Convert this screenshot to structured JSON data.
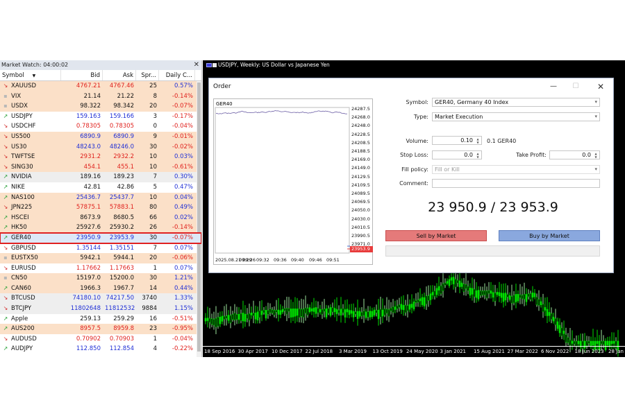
{
  "market_watch": {
    "title": "Market Watch: 04:00:02",
    "columns": [
      "Symbol",
      "Bid",
      "Ask",
      "Spr...",
      "Daily C..."
    ],
    "rows": [
      {
        "symbol": "XAUUSD",
        "bid": "4767.21",
        "ask": "4767.46",
        "spread": "25",
        "change": "0.57%",
        "dir": "down",
        "bg": "orange",
        "price_color": "red",
        "change_color": "blue"
      },
      {
        "symbol": "VIX",
        "bid": "21.14",
        "ask": "21.22",
        "spread": "8",
        "change": "-0.14%",
        "dir": "flat",
        "bg": "orange",
        "price_color": "black",
        "change_color": "red"
      },
      {
        "symbol": "USDX",
        "bid": "98.322",
        "ask": "98.342",
        "spread": "20",
        "change": "-0.07%",
        "dir": "flat",
        "bg": "orange",
        "price_color": "black",
        "change_color": "red"
      },
      {
        "symbol": "USDJPY",
        "bid": "159.163",
        "ask": "159.166",
        "spread": "3",
        "change": "-0.17%",
        "dir": "up",
        "bg": "white",
        "price_color": "blue",
        "change_color": "red"
      },
      {
        "symbol": "USDCHF",
        "bid": "0.78305",
        "ask": "0.78305",
        "spread": "0",
        "change": "-0.04%",
        "dir": "down",
        "bg": "white",
        "price_color": "red",
        "change_color": "red"
      },
      {
        "symbol": "US500",
        "bid": "6890.9",
        "ask": "6890.9",
        "spread": "9",
        "change": "-0.01%",
        "dir": "down",
        "bg": "orange",
        "price_color": "blue",
        "change_color": "red"
      },
      {
        "symbol": "US30",
        "bid": "48243.0",
        "ask": "48246.0",
        "spread": "30",
        "change": "-0.02%",
        "dir": "down",
        "bg": "orange",
        "price_color": "blue",
        "change_color": "red"
      },
      {
        "symbol": "TWFTSE",
        "bid": "2931.2",
        "ask": "2932.2",
        "spread": "10",
        "change": "0.03%",
        "dir": "down",
        "bg": "orange",
        "price_color": "red",
        "change_color": "blue"
      },
      {
        "symbol": "SING30",
        "bid": "454.1",
        "ask": "455.1",
        "spread": "10",
        "change": "-0.61%",
        "dir": "down",
        "bg": "orange",
        "price_color": "red",
        "change_color": "red"
      },
      {
        "symbol": "NVIDIA",
        "bid": "189.16",
        "ask": "189.23",
        "spread": "7",
        "change": "0.30%",
        "dir": "up",
        "bg": "gray",
        "price_color": "black",
        "change_color": "blue"
      },
      {
        "symbol": "NIKE",
        "bid": "42.81",
        "ask": "42.86",
        "spread": "5",
        "change": "0.47%",
        "dir": "up",
        "bg": "white",
        "price_color": "black",
        "change_color": "blue"
      },
      {
        "symbol": "NAS100",
        "bid": "25436.7",
        "ask": "25437.7",
        "spread": "10",
        "change": "0.04%",
        "dir": "up",
        "bg": "orange",
        "price_color": "blue",
        "change_color": "blue"
      },
      {
        "symbol": "JPN225",
        "bid": "57875.1",
        "ask": "57883.1",
        "spread": "80",
        "change": "0.49%",
        "dir": "down",
        "bg": "orange",
        "price_color": "red",
        "change_color": "blue"
      },
      {
        "symbol": "HSCEI",
        "bid": "8673.9",
        "ask": "8680.5",
        "spread": "66",
        "change": "0.02%",
        "dir": "up",
        "bg": "orange",
        "price_color": "black",
        "change_color": "blue"
      },
      {
        "symbol": "HK50",
        "bid": "25927.6",
        "ask": "25930.2",
        "spread": "26",
        "change": "-0.14%",
        "dir": "up",
        "bg": "orange",
        "price_color": "black",
        "change_color": "red"
      },
      {
        "symbol": "GER40",
        "bid": "23950.9",
        "ask": "23953.9",
        "spread": "30",
        "change": "-0.07%",
        "dir": "up",
        "bg": "blue",
        "price_color": "blue",
        "change_color": "red",
        "highlight": true
      },
      {
        "symbol": "GBPUSD",
        "bid": "1.35144",
        "ask": "1.35151",
        "spread": "7",
        "change": "0.07%",
        "dir": "down",
        "bg": "white",
        "price_color": "blue",
        "change_color": "blue"
      },
      {
        "symbol": "EUSTX50",
        "bid": "5942.1",
        "ask": "5944.1",
        "spread": "20",
        "change": "-0.06%",
        "dir": "flat",
        "bg": "orange",
        "price_color": "black",
        "change_color": "red"
      },
      {
        "symbol": "EURUSD",
        "bid": "1.17662",
        "ask": "1.17663",
        "spread": "1",
        "change": "0.07%",
        "dir": "down",
        "bg": "white",
        "price_color": "red",
        "change_color": "blue"
      },
      {
        "symbol": "CN50",
        "bid": "15197.0",
        "ask": "15200.0",
        "spread": "30",
        "change": "1.21%",
        "dir": "flat",
        "bg": "orange",
        "price_color": "black",
        "change_color": "blue"
      },
      {
        "symbol": "CAN60",
        "bid": "1966.3",
        "ask": "1967.7",
        "spread": "14",
        "change": "0.44%",
        "dir": "up",
        "bg": "orange",
        "price_color": "black",
        "change_color": "blue"
      },
      {
        "symbol": "BTCUSD",
        "bid": "74180.10",
        "ask": "74217.50",
        "spread": "3740",
        "change": "1.33%",
        "dir": "down",
        "bg": "gray",
        "price_color": "blue",
        "change_color": "blue"
      },
      {
        "symbol": "BTCJPY",
        "bid": "11802648",
        "ask": "11812532",
        "spread": "9884",
        "change": "1.15%",
        "dir": "down",
        "bg": "gray",
        "price_color": "blue",
        "change_color": "blue"
      },
      {
        "symbol": "Apple",
        "bid": "259.13",
        "ask": "259.29",
        "spread": "16",
        "change": "-0.51%",
        "dir": "up",
        "bg": "white",
        "price_color": "black",
        "change_color": "red"
      },
      {
        "symbol": "AUS200",
        "bid": "8957.5",
        "ask": "8959.8",
        "spread": "23",
        "change": "-0.95%",
        "dir": "up",
        "bg": "orange",
        "price_color": "red",
        "change_color": "red"
      },
      {
        "symbol": "AUDUSD",
        "bid": "0.70902",
        "ask": "0.70903",
        "spread": "1",
        "change": "-0.04%",
        "dir": "down",
        "bg": "white",
        "price_color": "red",
        "change_color": "red"
      },
      {
        "symbol": "AUDJPY",
        "bid": "112.850",
        "ask": "112.854",
        "spread": "4",
        "change": "-0.22%",
        "dir": "up",
        "bg": "white",
        "price_color": "blue",
        "change_color": "red"
      }
    ]
  },
  "chart_window": {
    "title": "USDJPY, Weekly:  US Dollar vs Japanese Yen",
    "x_labels": [
      "18 Sep 2016",
      "30 Apr 2017",
      "10 Dec 2017",
      "22 Jul 2018",
      "3 Mar 2019",
      "13 Oct 2019",
      "24 May 2020",
      "3 Jan 2021",
      "15 Aug 2021",
      "27 Mar 2022",
      "6 Nov 2022",
      "18 Jun 2023",
      "28 Jan"
    ],
    "colors": {
      "background": "#000000",
      "bull": "#00e000",
      "bear": "#ffffff"
    }
  },
  "order_dialog": {
    "title": "Order",
    "controls": {
      "minimize": "—",
      "maximize": "☐",
      "close": "✕"
    },
    "mini_chart": {
      "symbol": "GER40",
      "price_labels": [
        "24287.5",
        "24268.0",
        "24248.0",
        "24228.5",
        "24208.5",
        "24188.5",
        "24169.0",
        "24149.0",
        "24129.5",
        "24109.5",
        "24089.5",
        "24069.5",
        "24050.0",
        "24030.0",
        "24010.5",
        "23990.5",
        "23971.0"
      ],
      "current_bid": "23953.9",
      "time_labels": [
        "2025.08.21 09:26",
        "09:29",
        "09:32",
        "09:36",
        "09:40",
        "09:46",
        "09:51"
      ],
      "line_color": "#7b6fae"
    },
    "form": {
      "symbol_label": "Symbol:",
      "symbol_value": "GER40, Germany 40 Index",
      "type_label": "Type:",
      "type_value": "Market Execution",
      "volume_label": "Volume:",
      "volume_value": "0.10",
      "volume_note": "0.1 GER40",
      "stop_loss_label": "Stop Loss:",
      "stop_loss_value": "0.0",
      "take_profit_label": "Take Profit:",
      "take_profit_value": "0.0",
      "fill_policy_label": "Fill policy:",
      "fill_policy_value": "Fill or Kill",
      "comment_label": "Comment:",
      "comment_value": ""
    },
    "quote": "23 950.9 / 23 953.9",
    "sell_button": "Sell by Market",
    "buy_button": "Buy by Market"
  }
}
